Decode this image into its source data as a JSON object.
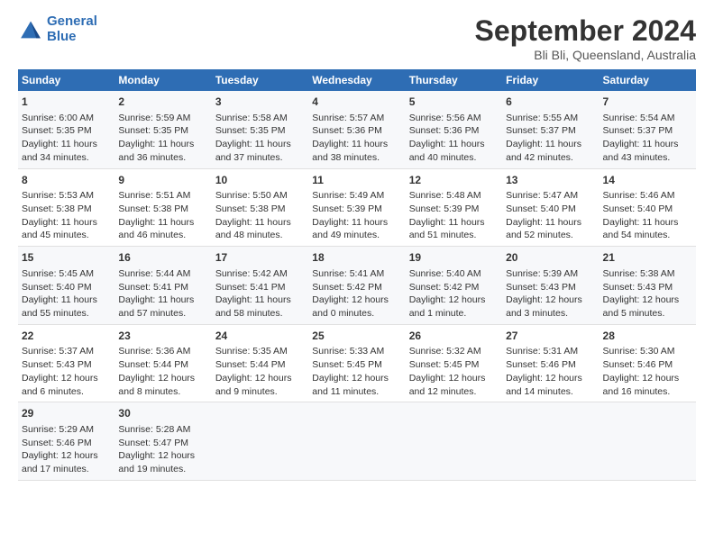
{
  "header": {
    "logo_line1": "General",
    "logo_line2": "Blue",
    "month": "September 2024",
    "location": "Bli Bli, Queensland, Australia"
  },
  "days_of_week": [
    "Sunday",
    "Monday",
    "Tuesday",
    "Wednesday",
    "Thursday",
    "Friday",
    "Saturday"
  ],
  "weeks": [
    [
      {
        "day": "1",
        "info": "Sunrise: 6:00 AM\nSunset: 5:35 PM\nDaylight: 11 hours\nand 34 minutes."
      },
      {
        "day": "2",
        "info": "Sunrise: 5:59 AM\nSunset: 5:35 PM\nDaylight: 11 hours\nand 36 minutes."
      },
      {
        "day": "3",
        "info": "Sunrise: 5:58 AM\nSunset: 5:35 PM\nDaylight: 11 hours\nand 37 minutes."
      },
      {
        "day": "4",
        "info": "Sunrise: 5:57 AM\nSunset: 5:36 PM\nDaylight: 11 hours\nand 38 minutes."
      },
      {
        "day": "5",
        "info": "Sunrise: 5:56 AM\nSunset: 5:36 PM\nDaylight: 11 hours\nand 40 minutes."
      },
      {
        "day": "6",
        "info": "Sunrise: 5:55 AM\nSunset: 5:37 PM\nDaylight: 11 hours\nand 42 minutes."
      },
      {
        "day": "7",
        "info": "Sunrise: 5:54 AM\nSunset: 5:37 PM\nDaylight: 11 hours\nand 43 minutes."
      }
    ],
    [
      {
        "day": "8",
        "info": "Sunrise: 5:53 AM\nSunset: 5:38 PM\nDaylight: 11 hours\nand 45 minutes."
      },
      {
        "day": "9",
        "info": "Sunrise: 5:51 AM\nSunset: 5:38 PM\nDaylight: 11 hours\nand 46 minutes."
      },
      {
        "day": "10",
        "info": "Sunrise: 5:50 AM\nSunset: 5:38 PM\nDaylight: 11 hours\nand 48 minutes."
      },
      {
        "day": "11",
        "info": "Sunrise: 5:49 AM\nSunset: 5:39 PM\nDaylight: 11 hours\nand 49 minutes."
      },
      {
        "day": "12",
        "info": "Sunrise: 5:48 AM\nSunset: 5:39 PM\nDaylight: 11 hours\nand 51 minutes."
      },
      {
        "day": "13",
        "info": "Sunrise: 5:47 AM\nSunset: 5:40 PM\nDaylight: 11 hours\nand 52 minutes."
      },
      {
        "day": "14",
        "info": "Sunrise: 5:46 AM\nSunset: 5:40 PM\nDaylight: 11 hours\nand 54 minutes."
      }
    ],
    [
      {
        "day": "15",
        "info": "Sunrise: 5:45 AM\nSunset: 5:40 PM\nDaylight: 11 hours\nand 55 minutes."
      },
      {
        "day": "16",
        "info": "Sunrise: 5:44 AM\nSunset: 5:41 PM\nDaylight: 11 hours\nand 57 minutes."
      },
      {
        "day": "17",
        "info": "Sunrise: 5:42 AM\nSunset: 5:41 PM\nDaylight: 11 hours\nand 58 minutes."
      },
      {
        "day": "18",
        "info": "Sunrise: 5:41 AM\nSunset: 5:42 PM\nDaylight: 12 hours\nand 0 minutes."
      },
      {
        "day": "19",
        "info": "Sunrise: 5:40 AM\nSunset: 5:42 PM\nDaylight: 12 hours\nand 1 minute."
      },
      {
        "day": "20",
        "info": "Sunrise: 5:39 AM\nSunset: 5:43 PM\nDaylight: 12 hours\nand 3 minutes."
      },
      {
        "day": "21",
        "info": "Sunrise: 5:38 AM\nSunset: 5:43 PM\nDaylight: 12 hours\nand 5 minutes."
      }
    ],
    [
      {
        "day": "22",
        "info": "Sunrise: 5:37 AM\nSunset: 5:43 PM\nDaylight: 12 hours\nand 6 minutes."
      },
      {
        "day": "23",
        "info": "Sunrise: 5:36 AM\nSunset: 5:44 PM\nDaylight: 12 hours\nand 8 minutes."
      },
      {
        "day": "24",
        "info": "Sunrise: 5:35 AM\nSunset: 5:44 PM\nDaylight: 12 hours\nand 9 minutes."
      },
      {
        "day": "25",
        "info": "Sunrise: 5:33 AM\nSunset: 5:45 PM\nDaylight: 12 hours\nand 11 minutes."
      },
      {
        "day": "26",
        "info": "Sunrise: 5:32 AM\nSunset: 5:45 PM\nDaylight: 12 hours\nand 12 minutes."
      },
      {
        "day": "27",
        "info": "Sunrise: 5:31 AM\nSunset: 5:46 PM\nDaylight: 12 hours\nand 14 minutes."
      },
      {
        "day": "28",
        "info": "Sunrise: 5:30 AM\nSunset: 5:46 PM\nDaylight: 12 hours\nand 16 minutes."
      }
    ],
    [
      {
        "day": "29",
        "info": "Sunrise: 5:29 AM\nSunset: 5:46 PM\nDaylight: 12 hours\nand 17 minutes."
      },
      {
        "day": "30",
        "info": "Sunrise: 5:28 AM\nSunset: 5:47 PM\nDaylight: 12 hours\nand 19 minutes."
      },
      {
        "day": "",
        "info": ""
      },
      {
        "day": "",
        "info": ""
      },
      {
        "day": "",
        "info": ""
      },
      {
        "day": "",
        "info": ""
      },
      {
        "day": "",
        "info": ""
      }
    ]
  ]
}
